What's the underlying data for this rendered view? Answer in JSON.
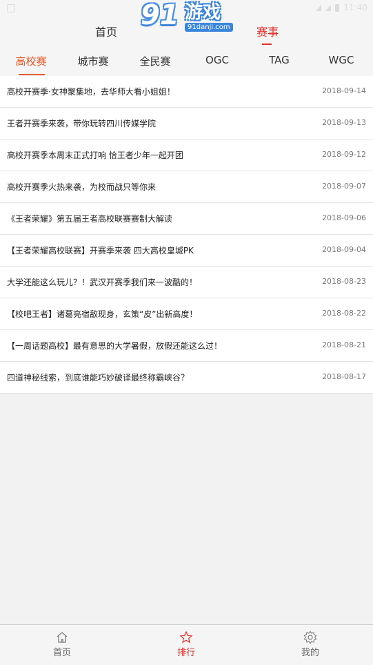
{
  "status_bar": {
    "time": "11:40"
  },
  "header": {
    "home_label": "首页",
    "events_label": "赛事",
    "logo": {
      "number": "91",
      "word": "游戏",
      "domain": "91danji.com"
    }
  },
  "categories": [
    "高校赛",
    "城市赛",
    "全民赛",
    "OGC",
    "TAG",
    "WGC"
  ],
  "articles": [
    {
      "title": "高校开赛季·女神聚集地，去华师大看小姐姐！",
      "date": "2018-09-14"
    },
    {
      "title": "王者开赛季来袭，带你玩转四川传媒学院",
      "date": "2018-09-13"
    },
    {
      "title": "高校开赛季本周末正式打响 恰王者少年一起开团",
      "date": "2018-09-12"
    },
    {
      "title": "高校开赛季火热来袭，为校而战只等你来",
      "date": "2018-09-07"
    },
    {
      "title": "《王者荣耀》第五届王者高校联赛赛制大解读",
      "date": "2018-09-06"
    },
    {
      "title": "【王者荣耀高校联赛】开赛季来袭 四大高校皇城PK",
      "date": "2018-09-04"
    },
    {
      "title": "大学还能这么玩儿？！武汉开赛季我们来一波酷的！",
      "date": "2018-08-23"
    },
    {
      "title": "【校吧王者】诸葛亮宿敌现身，玄策“皮”出新高度！",
      "date": "2018-08-22"
    },
    {
      "title": "【一周话题高校】最有意思的大学暑假，放假还能这么过！",
      "date": "2018-08-21"
    },
    {
      "title": "四道神秘线索，到底谁能巧妙破译最终称霸峡谷？",
      "date": "2018-08-17"
    }
  ],
  "bottom_nav": {
    "home": "首页",
    "ranking": "排行",
    "mine": "我的"
  },
  "colors": {
    "accent_red": "#e8312c",
    "accent_orange": "#e85a2a",
    "logo_blue": "#3b86dd"
  }
}
